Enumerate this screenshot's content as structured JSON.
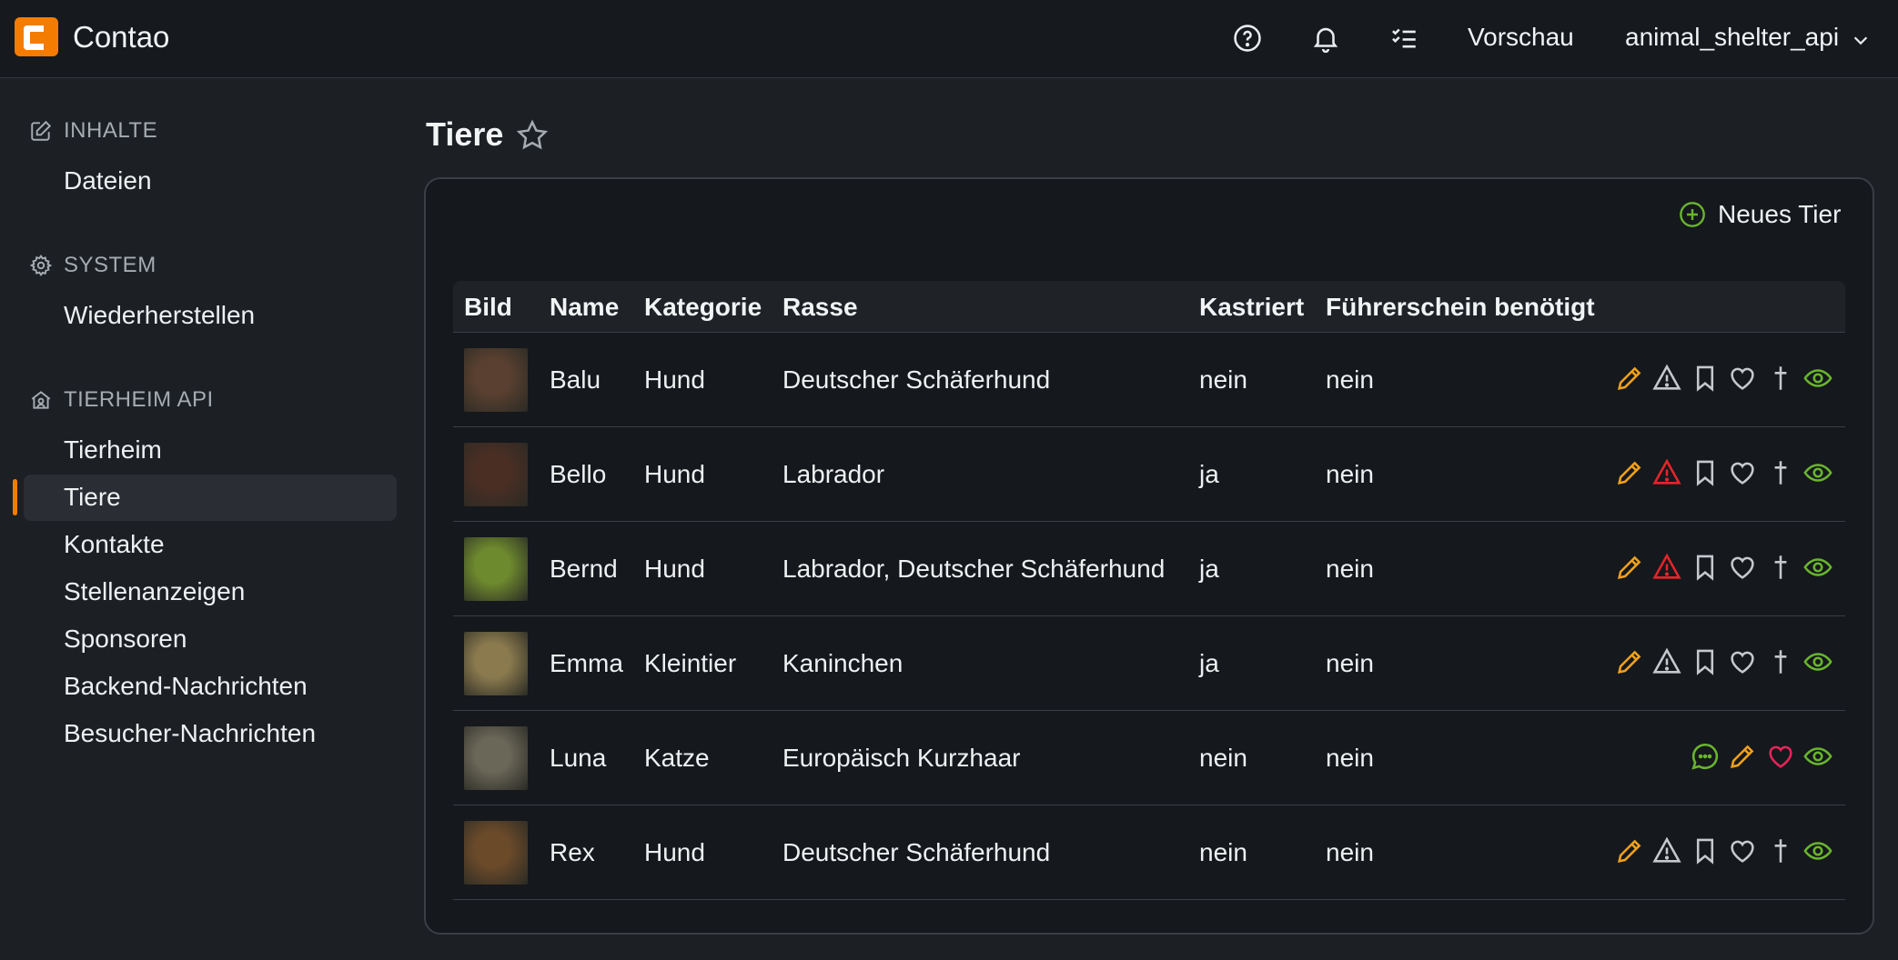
{
  "app": {
    "name": "Contao"
  },
  "topbar": {
    "preview_label": "Vorschau",
    "user_label": "animal_shelter_api",
    "icons": [
      "help-icon",
      "bell-icon",
      "tasks-icon",
      "chevron-down-icon"
    ]
  },
  "sidebar": {
    "groups": [
      {
        "title": "INHALTE",
        "icon": "edit-icon",
        "items": [
          {
            "label": "Dateien"
          }
        ]
      },
      {
        "title": "SYSTEM",
        "icon": "gear-icon",
        "items": [
          {
            "label": "Wiederherstellen"
          }
        ]
      },
      {
        "title": "TIERHEIM API",
        "icon": "shelter-icon",
        "items": [
          {
            "label": "Tierheim"
          },
          {
            "label": "Tiere",
            "active": true
          },
          {
            "label": "Kontakte"
          },
          {
            "label": "Stellenanzeigen"
          },
          {
            "label": "Sponsoren"
          },
          {
            "label": "Backend-Nachrichten"
          },
          {
            "label": "Besucher-Nachrichten"
          }
        ]
      }
    ]
  },
  "main": {
    "title": "Tiere",
    "new_button_label": "Neues Tier",
    "table": {
      "columns": [
        "Bild",
        "Name",
        "Kategorie",
        "Rasse",
        "Kastriert",
        "Führerschein benötigt"
      ],
      "rows": [
        {
          "name": "Balu",
          "category": "Hund",
          "breed": "Deutscher Schäferhund",
          "neutered": "nein",
          "license": "nein",
          "warning": "normal",
          "heart": "normal",
          "comment": false,
          "img": "#5a4030"
        },
        {
          "name": "Bello",
          "category": "Hund",
          "breed": "Labrador",
          "neutered": "ja",
          "license": "nein",
          "warning": "alert",
          "heart": "normal",
          "comment": false,
          "img": "#4a2e24"
        },
        {
          "name": "Bernd",
          "category": "Hund",
          "breed": "Labrador, Deutscher Schäferhund",
          "neutered": "ja",
          "license": "nein",
          "warning": "alert",
          "heart": "normal",
          "comment": false,
          "img": "#6e8a2e"
        },
        {
          "name": "Emma",
          "category": "Kleintier",
          "breed": "Kaninchen",
          "neutered": "ja",
          "license": "nein",
          "warning": "normal",
          "heart": "normal",
          "comment": false,
          "img": "#8a7a4e"
        },
        {
          "name": "Luna",
          "category": "Katze",
          "breed": "Europäisch Kurzhaar",
          "neutered": "nein",
          "license": "nein",
          "warning": "none",
          "heart": "active",
          "comment": true,
          "img": "#6a6658"
        },
        {
          "name": "Rex",
          "category": "Hund",
          "breed": "Deutscher Schäferhund",
          "neutered": "nein",
          "license": "nein",
          "warning": "normal",
          "heart": "normal",
          "comment": false,
          "img": "#6b4a2a"
        }
      ]
    }
  },
  "colors": {
    "accent": "#f47c00",
    "edit": "#f0a11a",
    "alert": "#e5252a",
    "view": "#69b52e",
    "heart_active": "#e8245a",
    "icon_muted": "#c5c9ce"
  }
}
